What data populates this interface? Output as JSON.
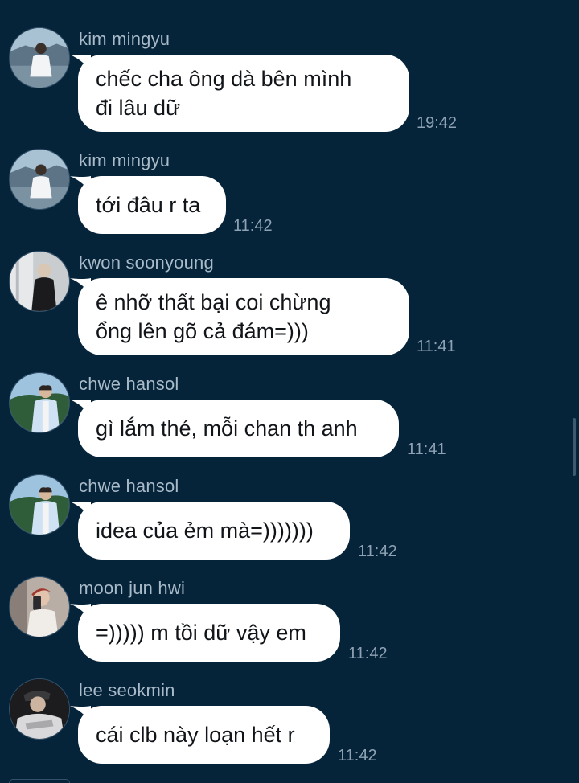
{
  "messages": [
    {
      "sender": "kim mingyu",
      "lines": [
        "chếc cha ông dà bên mình",
        "đi lâu dữ"
      ],
      "time": "19:42",
      "avatar": "avatar-kim-mingyu"
    },
    {
      "sender": "kim mingyu",
      "lines": [
        "tới đâu r ta"
      ],
      "time": "11:42",
      "avatar": "avatar-kim-mingyu"
    },
    {
      "sender": "kwon soonyoung",
      "lines": [
        "ê nhỡ thất bại coi chừng",
        "ổng lên gõ cả đám=)))"
      ],
      "time": "11:41",
      "avatar": "avatar-kwon-soonyoung"
    },
    {
      "sender": "chwe hansol",
      "lines": [
        "gì lắm thé, mỗi chan th anh"
      ],
      "time": "11:41",
      "avatar": "avatar-chwe-hansol"
    },
    {
      "sender": "chwe hansol",
      "lines": [
        "idea của ẻm mà=)))))))"
      ],
      "time": "11:42",
      "avatar": "avatar-chwe-hansol"
    },
    {
      "sender": "moon jun hwi",
      "lines": [
        "=))))) m tồi dữ vậy em"
      ],
      "time": "11:42",
      "avatar": "avatar-moon-jun-hwi"
    },
    {
      "sender": "lee seokmin",
      "lines": [
        "cái clb này loạn hết r"
      ],
      "time": "11:42",
      "avatar": "avatar-lee-seokmin"
    }
  ],
  "theme": {
    "background": "#052339",
    "bubble": "#ffffff",
    "sender_color": "#a9bac8",
    "time_color": "#8ea2b3"
  }
}
